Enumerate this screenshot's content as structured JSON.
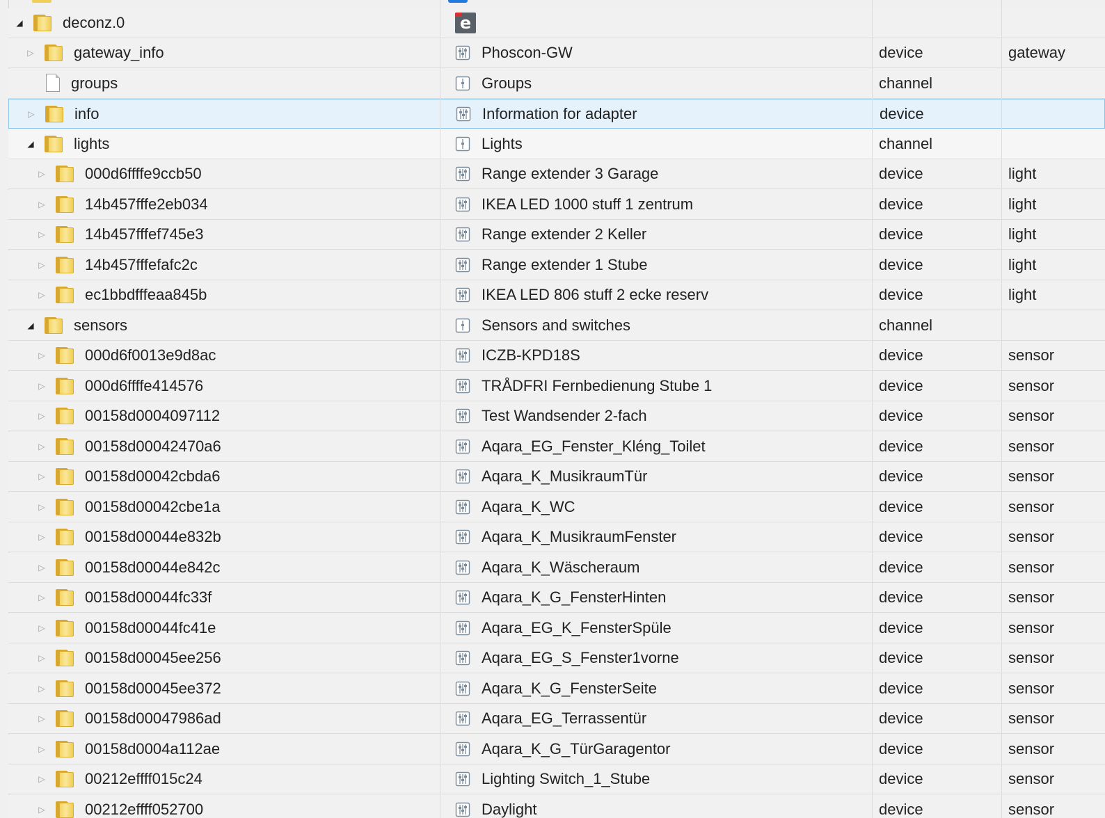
{
  "root": {
    "id": "deconz.0",
    "icon": "e-logo-icon"
  },
  "rows": [
    {
      "id": "gateway_info",
      "name": "Phoscon-GW",
      "role": "device",
      "type": "gateway"
    },
    {
      "id": "groups",
      "name": "Groups",
      "role": "channel",
      "type": ""
    },
    {
      "id": "info",
      "name": "Information for adapter",
      "role": "device",
      "type": ""
    },
    {
      "id": "lights",
      "name": "Lights",
      "role": "channel",
      "type": ""
    },
    {
      "id": "000d6ffffe9ccb50",
      "name": "Range extender 3 Garage",
      "role": "device",
      "type": "light"
    },
    {
      "id": "14b457fffe2eb034",
      "name": "IKEA LED 1000 stuff 1 zentrum",
      "role": "device",
      "type": "light"
    },
    {
      "id": "14b457fffef745e3",
      "name": "Range extender 2 Keller",
      "role": "device",
      "type": "light"
    },
    {
      "id": "14b457fffefafc2c",
      "name": "Range extender 1 Stube",
      "role": "device",
      "type": "light"
    },
    {
      "id": "ec1bbdfffeaa845b",
      "name": "IKEA LED 806 stuff 2 ecke reserv",
      "role": "device",
      "type": "light"
    },
    {
      "id": "sensors",
      "name": "Sensors and switches",
      "role": "channel",
      "type": ""
    },
    {
      "id": "000d6f0013e9d8ac",
      "name": "ICZB-KPD18S",
      "role": "device",
      "type": "sensor"
    },
    {
      "id": "000d6ffffe414576",
      "name": "TRÅDFRI Fernbedienung Stube 1",
      "role": "device",
      "type": "sensor"
    },
    {
      "id": "00158d0004097112",
      "name": "Test Wandsender 2-fach",
      "role": "device",
      "type": "sensor"
    },
    {
      "id": "00158d00042470a6",
      "name": "Aqara_EG_Fenster_Kléng_Toilet",
      "role": "device",
      "type": "sensor"
    },
    {
      "id": "00158d00042cbda6",
      "name": "Aqara_K_MusikraumTür",
      "role": "device",
      "type": "sensor"
    },
    {
      "id": "00158d00042cbe1a",
      "name": "Aqara_K_WC",
      "role": "device",
      "type": "sensor"
    },
    {
      "id": "00158d00044e832b",
      "name": "Aqara_K_MusikraumFenster",
      "role": "device",
      "type": "sensor"
    },
    {
      "id": "00158d00044e842c",
      "name": "Aqara_K_Wäscheraum",
      "role": "device",
      "type": "sensor"
    },
    {
      "id": "00158d00044fc33f",
      "name": "Aqara_K_G_FensterHinten",
      "role": "device",
      "type": "sensor"
    },
    {
      "id": "00158d00044fc41e",
      "name": "Aqara_EG_K_FensterSpüle",
      "role": "device",
      "type": "sensor"
    },
    {
      "id": "00158d00045ee256",
      "name": "Aqara_EG_S_Fenster1vorne",
      "role": "device",
      "type": "sensor"
    },
    {
      "id": "00158d00045ee372",
      "name": "Aqara_K_G_FensterSeite",
      "role": "device",
      "type": "sensor"
    },
    {
      "id": "00158d00047986ad",
      "name": "Aqara_EG_Terrassentür",
      "role": "device",
      "type": "sensor"
    },
    {
      "id": "00158d0004a112ae",
      "name": "Aqara_K_G_TürGaragentor",
      "role": "device",
      "type": "sensor"
    },
    {
      "id": "00212effff015c24",
      "name": "Lighting Switch_1_Stube",
      "role": "device",
      "type": "sensor"
    },
    {
      "id": "00212effff052700",
      "name": "Daylight",
      "role": "device",
      "type": "sensor"
    }
  ]
}
